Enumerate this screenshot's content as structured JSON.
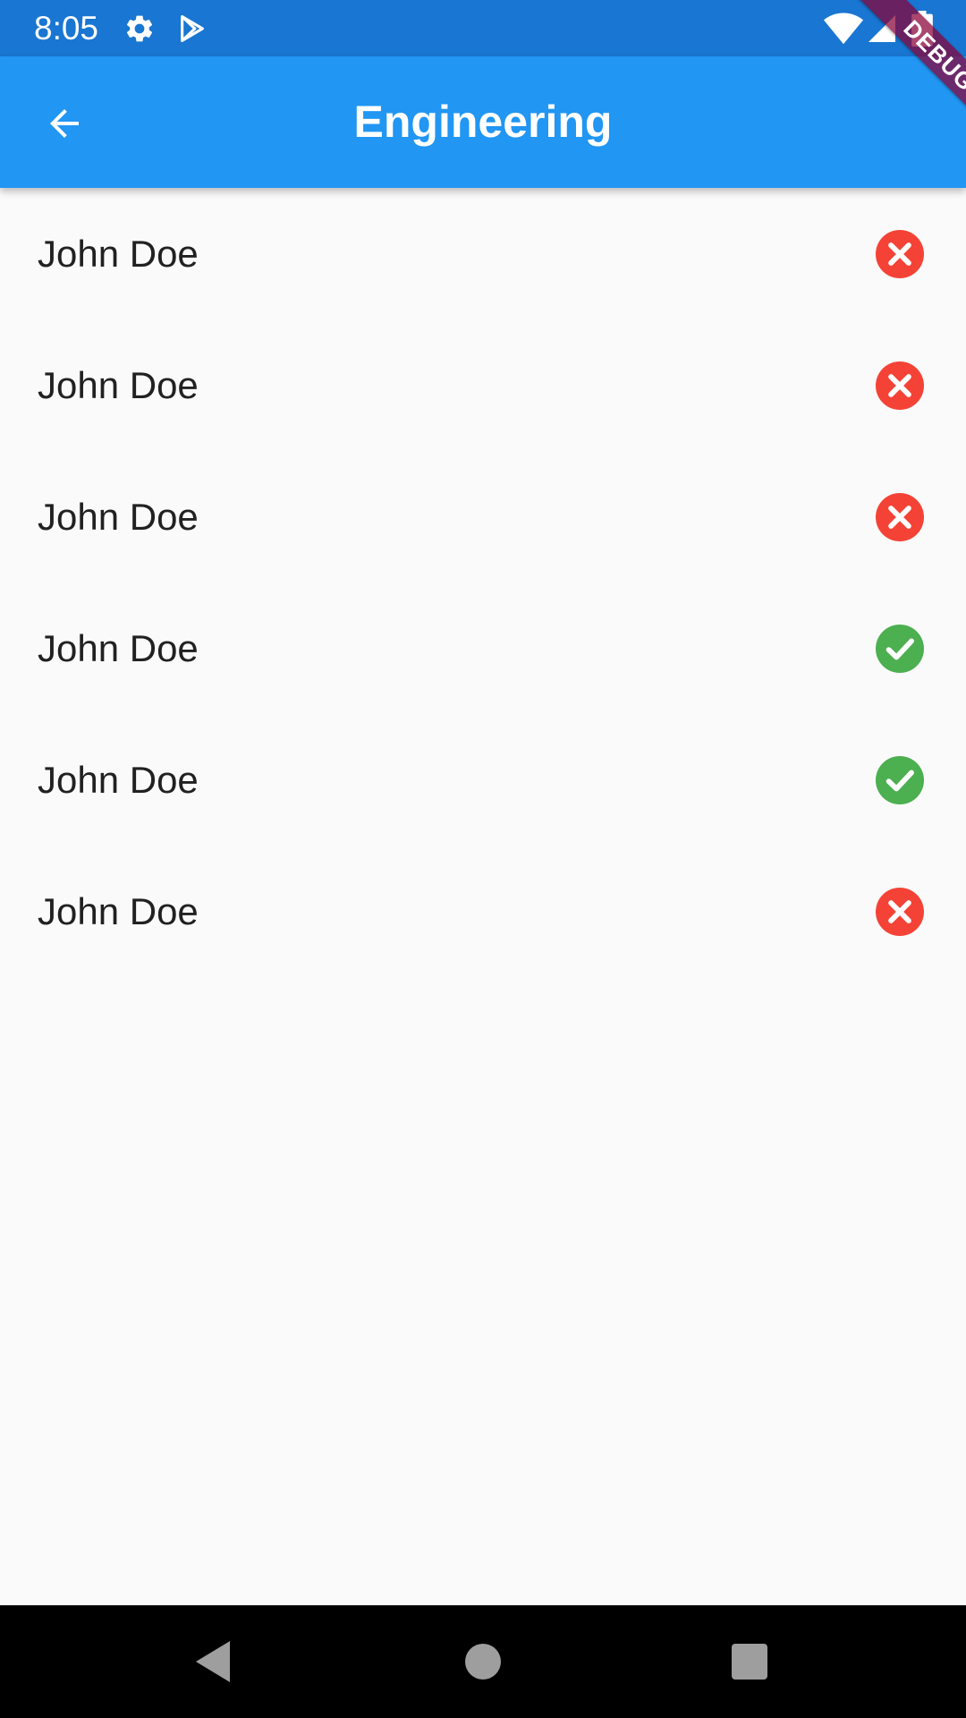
{
  "status_bar": {
    "time": "8:05",
    "icons": [
      "gear-icon",
      "play-store-icon",
      "wifi-icon",
      "signal-icon",
      "battery-icon"
    ]
  },
  "app_bar": {
    "title": "Engineering",
    "back_icon": "arrow-back-icon"
  },
  "debug_banner": {
    "label": "DEBUG"
  },
  "list": {
    "items": [
      {
        "name": "John Doe",
        "status": "cancel"
      },
      {
        "name": "John Doe",
        "status": "cancel"
      },
      {
        "name": "John Doe",
        "status": "cancel"
      },
      {
        "name": "John Doe",
        "status": "check"
      },
      {
        "name": "John Doe",
        "status": "check"
      },
      {
        "name": "John Doe",
        "status": "cancel"
      }
    ]
  },
  "colors": {
    "status_bar": "#1976D2",
    "app_bar": "#2196F3",
    "cancel": "#F44336",
    "check": "#4CAF50",
    "background": "#FAFAFA"
  },
  "nav_bar": {
    "icons": [
      "back-triangle-icon",
      "home-circle-icon",
      "recents-square-icon"
    ]
  }
}
